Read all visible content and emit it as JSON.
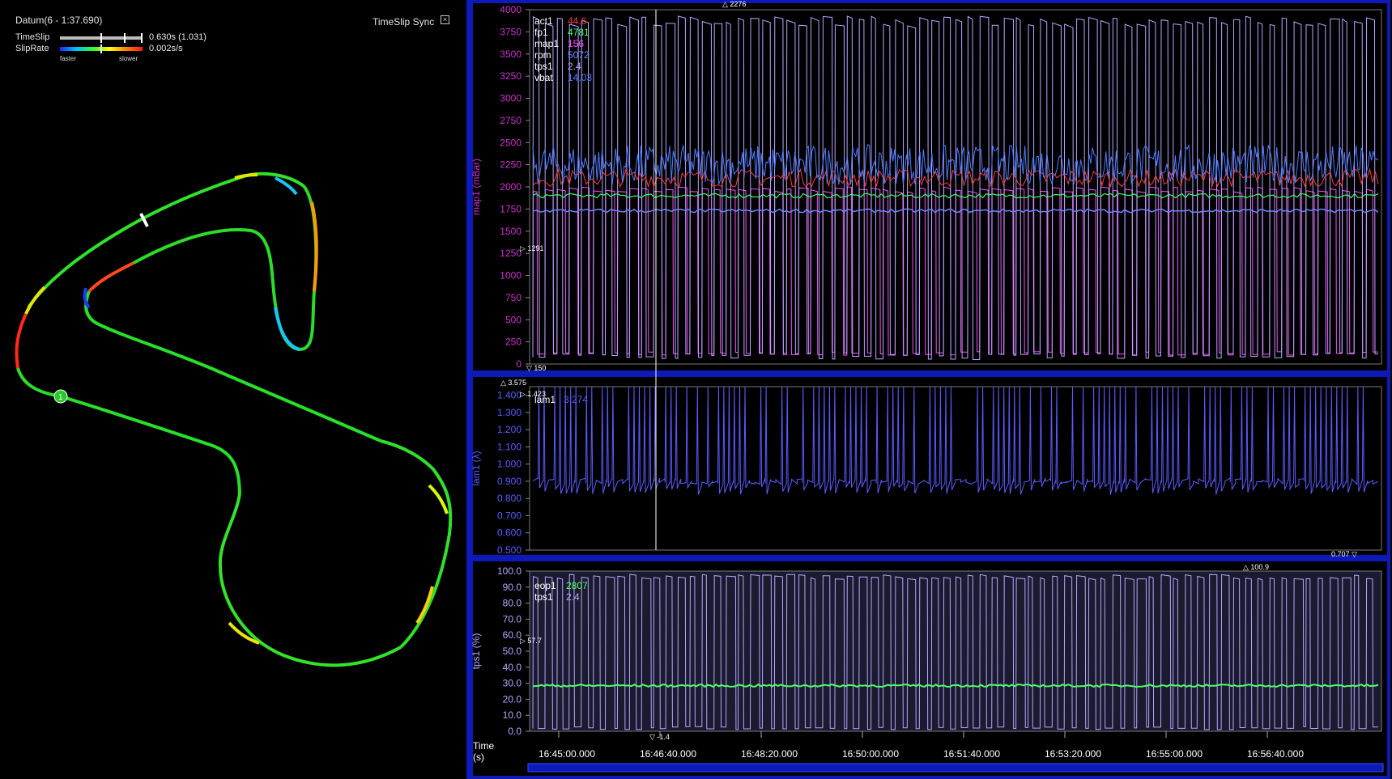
{
  "map": {
    "datum_title": "Datum(6 - 1:37.690)",
    "timeslip_label": "TimeSlip",
    "timeslip_value": "0.630s (1.031)",
    "sliprate_label": "SlipRate",
    "sliprate_value": "0.002s/s",
    "faster_label": "faster",
    "slower_label": "slower",
    "sync_label": "TimeSlip Sync",
    "marker_label": "1"
  },
  "chart_data": [
    {
      "type": "line",
      "ylabel": "map1 (mBar)",
      "ylim": [
        0,
        4000
      ],
      "yticks": [
        "0",
        "250",
        "500",
        "750",
        "1000",
        "1250",
        "1500",
        "1750",
        "2000",
        "2250",
        "2500",
        "2750",
        "3000",
        "3250",
        "3500",
        "3750",
        "4000"
      ],
      "max_marker": "2276",
      "left_marker": "1291",
      "min_marker": "150",
      "legend": [
        {
          "name": "act1",
          "value": "44.6",
          "color": "#ff3b3b"
        },
        {
          "name": "fp1",
          "value": "4781",
          "color": "#3dff6a"
        },
        {
          "name": "map1",
          "value": "156",
          "color": "#ff4dff"
        },
        {
          "name": "rpm",
          "value": "5072",
          "color": "#6f86ff"
        },
        {
          "name": "tps1",
          "value": "2.4",
          "color": "#b4a7ff"
        },
        {
          "name": "vbat",
          "value": "14.03",
          "color": "#4d7dff"
        }
      ]
    },
    {
      "type": "line",
      "ylabel": "lam1 (λ)",
      "ylim": [
        0.5,
        1.45
      ],
      "yticks": [
        "0.500",
        "0.600",
        "0.700",
        "0.800",
        "0.900",
        "1.000",
        "1.100",
        "1.200",
        "1.300",
        "1.400"
      ],
      "max_marker": "3.575",
      "left_marker": "1.423",
      "min_marker": "0.707",
      "legend": [
        {
          "name": "lam1",
          "value": "3.274",
          "color": "#5b5bff"
        }
      ]
    },
    {
      "type": "line",
      "ylabel": "tps1 (%)",
      "ylim": [
        0,
        100
      ],
      "yticks": [
        "0.0",
        "10.0",
        "20.0",
        "30.0",
        "40.0",
        "50.0",
        "60.0",
        "70.0",
        "80.0",
        "90.0",
        "100.0"
      ],
      "max_marker": "100.9",
      "left_marker": "57.7",
      "min_marker": "-1.4",
      "legend": [
        {
          "name": "eop1",
          "value": "2807",
          "color": "#4dff6a"
        },
        {
          "name": "tps1",
          "value": "2.4",
          "color": "#b4a7ff"
        }
      ],
      "xlabel": "Time\n(s)",
      "xticks": [
        "16:45:00.000",
        "16:46:40.000",
        "16:48:20.000",
        "16:50:00.000",
        "16:51:40.000",
        "16:53:20.000",
        "16:55:00.000",
        "16:56:40.000"
      ]
    }
  ]
}
